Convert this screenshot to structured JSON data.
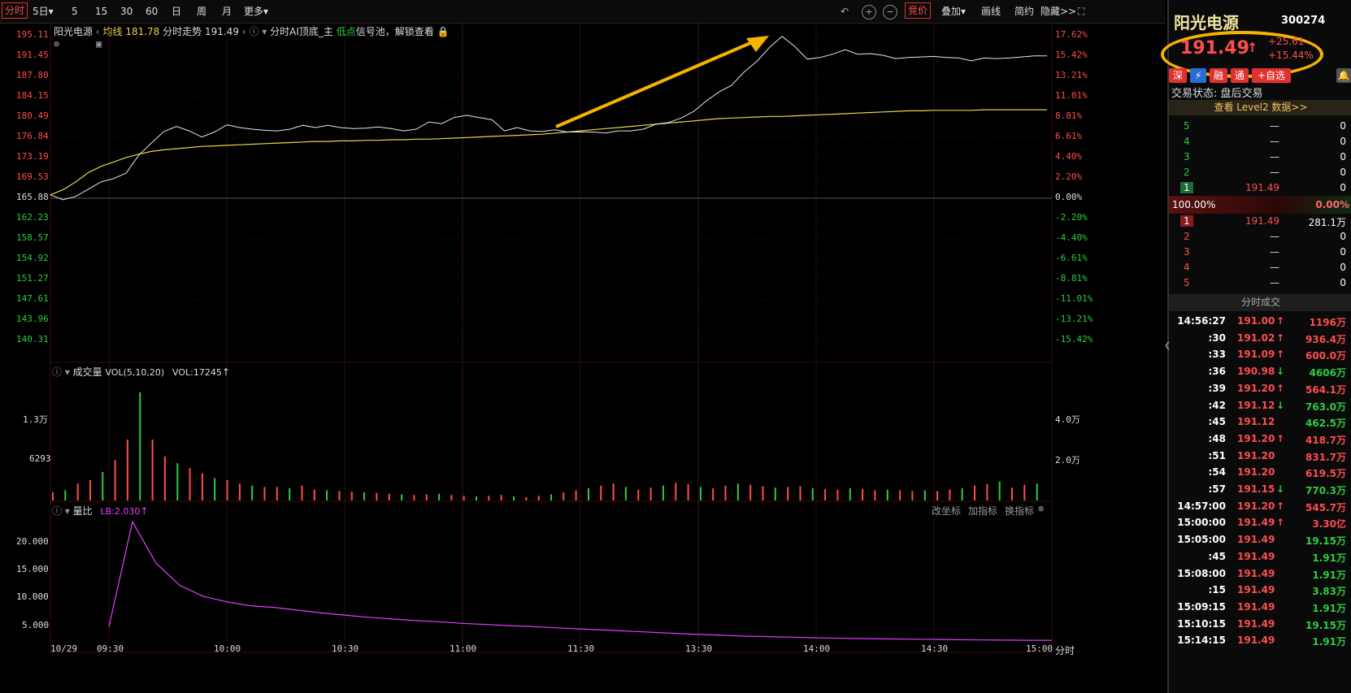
{
  "toolbar": {
    "tabs": [
      "分时",
      "5日",
      "5",
      "15",
      "30",
      "60",
      "日",
      "周",
      "月",
      "更多"
    ],
    "right_items": [
      "竞价",
      "叠加",
      "画线",
      "简约",
      "隐藏>>"
    ]
  },
  "chart_header": {
    "stock_name": "阳光电源",
    "avg_label": "均线",
    "avg_value": "181.78",
    "trend_label": "分时走势",
    "trend_value": "191.49",
    "ai_label": "分时AI顶底_主",
    "low_label": "低点",
    "signal_label": "信号池，解锁查看"
  },
  "price_axis": {
    "left_labels": [
      "195.11",
      "191.45",
      "187.80",
      "184.15",
      "180.49",
      "176.84",
      "173.19",
      "169.53",
      "165.88",
      "162.23",
      "158.57",
      "154.92",
      "151.27",
      "147.61",
      "143.96",
      "140.31"
    ],
    "right_labels": [
      "17.62%",
      "15.42%",
      "13.21%",
      "11.01%",
      "8.81%",
      "6.61%",
      "4.40%",
      "2.20%",
      "0.00%",
      "-2.20%",
      "-4.40%",
      "-6.61%",
      "-8.81%",
      "-11.01%",
      "-13.21%",
      "-15.42%"
    ]
  },
  "volume_panel": {
    "title": "成交量",
    "params": "VOL(5,10,20)",
    "vol_label": "VOL:17245",
    "left_labels": [
      "1.3万",
      "6293"
    ],
    "right_labels": [
      "4.0万",
      "2.0万"
    ]
  },
  "ratio_panel": {
    "title": "量比",
    "lb_label": "LB:2.030",
    "buttons": [
      "改坐标",
      "加指标",
      "换指标"
    ],
    "left_labels": [
      "20.000",
      "15.000",
      "10.000",
      "5.000"
    ]
  },
  "time_axis": [
    "10/29",
    "09:30",
    "10:00",
    "10:30",
    "11:00",
    "11:30",
    "13:30",
    "14:00",
    "14:30",
    "15:00"
  ],
  "time_axis_unit": "分时",
  "chart_data": {
    "type": "line",
    "title": "阳光电源 分时走势",
    "prev_close": 165.88,
    "ylim": [
      140.31,
      195.11
    ],
    "price_series": [
      166.5,
      165.6,
      166.2,
      167.5,
      168.8,
      169.4,
      170.4,
      173.6,
      175.8,
      177.9,
      178.8,
      178.0,
      176.9,
      177.8,
      179.1,
      178.6,
      178.3,
      178.1,
      178.0,
      178.3,
      179.0,
      178.6,
      179.0,
      178.6,
      178.4,
      178.5,
      178.7,
      178.4,
      178.0,
      178.3,
      179.6,
      179.3,
      180.4,
      180.8,
      180.4,
      180.0,
      178.0,
      178.6,
      178.0,
      177.9,
      178.2,
      177.8,
      177.8,
      177.8,
      177.6,
      178.0,
      178.0,
      178.3,
      179.2,
      179.5,
      180.3,
      181.5,
      183.4,
      185.0,
      186.2,
      188.6,
      190.5,
      193.0,
      195.0,
      193.2,
      190.9,
      191.2,
      191.8,
      192.6,
      191.8,
      191.9,
      191.6,
      191.0,
      191.2,
      191.3,
      191.4,
      191.2,
      191.1,
      190.6,
      191.1,
      191.0,
      191.1,
      191.3,
      191.5,
      191.49
    ],
    "avg_series": [
      166.5,
      167.4,
      168.8,
      170.5,
      171.6,
      172.4,
      173.2,
      173.8,
      174.3,
      174.6,
      174.8,
      175.0,
      175.2,
      175.3,
      175.4,
      175.5,
      175.6,
      175.7,
      175.8,
      175.9,
      176.0,
      176.1,
      176.1,
      176.2,
      176.2,
      176.3,
      176.3,
      176.4,
      176.4,
      176.5,
      176.5,
      176.6,
      176.7,
      176.8,
      176.9,
      177.0,
      177.1,
      177.2,
      177.3,
      177.4,
      177.6,
      177.8,
      178.0,
      178.2,
      178.4,
      178.6,
      178.8,
      179.0,
      179.2,
      179.4,
      179.6,
      179.8,
      180.0,
      180.2,
      180.3,
      180.4,
      180.5,
      180.6,
      180.6,
      180.7,
      180.8,
      180.9,
      181.0,
      181.1,
      181.2,
      181.3,
      181.4,
      181.5,
      181.6,
      181.6,
      181.7,
      181.7,
      181.7,
      181.7,
      181.8,
      181.8,
      181.8,
      181.8,
      181.8,
      181.78
    ],
    "volume_series": [
      1200,
      1500,
      2500,
      3000,
      4200,
      6000,
      9000,
      16000,
      9000,
      6500,
      5500,
      4800,
      4000,
      3300,
      3000,
      2500,
      2200,
      2000,
      2000,
      1800,
      2200,
      1600,
      1500,
      1400,
      1300,
      1200,
      1100,
      1000,
      900,
      800,
      900,
      1000,
      800,
      700,
      600,
      700,
      800,
      600,
      500,
      700,
      900,
      1200,
      1500,
      1800,
      2200,
      2500,
      2000,
      1600,
      1900,
      2200,
      2600,
      2400,
      2000,
      1800,
      2200,
      2500,
      2300,
      2100,
      1900,
      2000,
      2100,
      1800,
      1700,
      1600,
      1800,
      1700,
      1500,
      1600,
      1500,
      1400,
      1500,
      1400,
      1600,
      1800,
      2200,
      2400,
      2800,
      1900,
      2300,
      2500
    ],
    "ratio_series": [
      4.5,
      23.5,
      16.0,
      12.0,
      10.0,
      9.0,
      8.3,
      8.0,
      7.5,
      7.0,
      6.6,
      6.2,
      5.9,
      5.6,
      5.4,
      5.1,
      4.9,
      4.7,
      4.5,
      4.3,
      4.1,
      3.9,
      3.7,
      3.5,
      3.3,
      3.1,
      2.95,
      2.8,
      2.7,
      2.6,
      2.5,
      2.4,
      2.35,
      2.3,
      2.25,
      2.2,
      2.15,
      2.1,
      2.08,
      2.05,
      2.03
    ]
  },
  "side": {
    "stock_name": "阳光电源",
    "code": "300274",
    "price": "191.49",
    "change": "+25.61",
    "change_pct": "+15.44%",
    "badges": [
      "深",
      "融",
      "通",
      "+自选"
    ],
    "trade_status": "交易状态: 盘后交易",
    "level2_link": "查看 Level2 数据>>",
    "sell_levels": [
      {
        "level": "5",
        "price": "—",
        "vol": "0"
      },
      {
        "level": "4",
        "price": "—",
        "vol": "0"
      },
      {
        "level": "3",
        "price": "—",
        "vol": "0"
      },
      {
        "level": "2",
        "price": "—",
        "vol": "0"
      },
      {
        "level": "1",
        "price": "191.49",
        "vol": "0"
      }
    ],
    "ratio_left": "100.00%",
    "ratio_right": "0.00%",
    "buy_levels": [
      {
        "level": "1",
        "price": "191.49",
        "vol": "281.1万"
      },
      {
        "level": "2",
        "price": "—",
        "vol": "0"
      },
      {
        "level": "3",
        "price": "—",
        "vol": "0"
      },
      {
        "level": "4",
        "price": "—",
        "vol": "0"
      },
      {
        "level": "5",
        "price": "—",
        "vol": "0"
      }
    ],
    "ticks_title": "分时成交",
    "ticks": [
      {
        "time": "14:56:27",
        "price": "191.00",
        "dir": "↑",
        "vol": "1196万",
        "pc": "red",
        "vc": "red"
      },
      {
        "time": ":30",
        "price": "191.02",
        "dir": "↑",
        "vol": "936.4万",
        "pc": "red",
        "vc": "red"
      },
      {
        "time": ":33",
        "price": "191.09",
        "dir": "↑",
        "vol": "600.0万",
        "pc": "red",
        "vc": "red"
      },
      {
        "time": ":36",
        "price": "190.98",
        "dir": "↓",
        "vol": "4606万",
        "pc": "red",
        "vc": "green"
      },
      {
        "time": ":39",
        "price": "191.20",
        "dir": "↑",
        "vol": "564.1万",
        "pc": "red",
        "vc": "red"
      },
      {
        "time": ":42",
        "price": "191.12",
        "dir": "↓",
        "vol": "763.0万",
        "pc": "red",
        "vc": "green"
      },
      {
        "time": ":45",
        "price": "191.12",
        "dir": "",
        "vol": "462.5万",
        "pc": "red",
        "vc": "green"
      },
      {
        "time": ":48",
        "price": "191.20",
        "dir": "↑",
        "vol": "418.7万",
        "pc": "red",
        "vc": "red"
      },
      {
        "time": ":51",
        "price": "191.20",
        "dir": "",
        "vol": "831.7万",
        "pc": "red",
        "vc": "red"
      },
      {
        "time": ":54",
        "price": "191.20",
        "dir": "",
        "vol": "619.5万",
        "pc": "red",
        "vc": "red"
      },
      {
        "time": ":57",
        "price": "191.15",
        "dir": "↓",
        "vol": "770.3万",
        "pc": "red",
        "vc": "green"
      },
      {
        "time": "14:57:00",
        "price": "191.20",
        "dir": "↑",
        "vol": "545.7万",
        "pc": "red",
        "vc": "red"
      },
      {
        "time": "15:00:00",
        "price": "191.49",
        "dir": "↑",
        "vol": "3.30亿",
        "pc": "red",
        "vc": "red"
      },
      {
        "time": "15:05:00",
        "price": "191.49",
        "dir": "",
        "vol": "19.15万",
        "pc": "red",
        "vc": "green"
      },
      {
        "time": ":45",
        "price": "191.49",
        "dir": "",
        "vol": "1.91万",
        "pc": "red",
        "vc": "green"
      },
      {
        "time": "15:08:00",
        "price": "191.49",
        "dir": "",
        "vol": "1.91万",
        "pc": "red",
        "vc": "green"
      },
      {
        "time": ":15",
        "price": "191.49",
        "dir": "",
        "vol": "3.83万",
        "pc": "red",
        "vc": "green"
      },
      {
        "time": "15:09:15",
        "price": "191.49",
        "dir": "",
        "vol": "1.91万",
        "pc": "red",
        "vc": "green"
      },
      {
        "time": "15:10:15",
        "price": "191.49",
        "dir": "",
        "vol": "19.15万",
        "pc": "red",
        "vc": "green"
      },
      {
        "time": "15:14:15",
        "price": "191.49",
        "dir": "",
        "vol": "1.91万",
        "pc": "red",
        "vc": "green"
      }
    ]
  },
  "colors": {
    "up": "#ff4d4d",
    "down": "#2ecc40",
    "avg": "#e8d44d",
    "ratio": "#e040fb",
    "accent": "#f5b400"
  }
}
